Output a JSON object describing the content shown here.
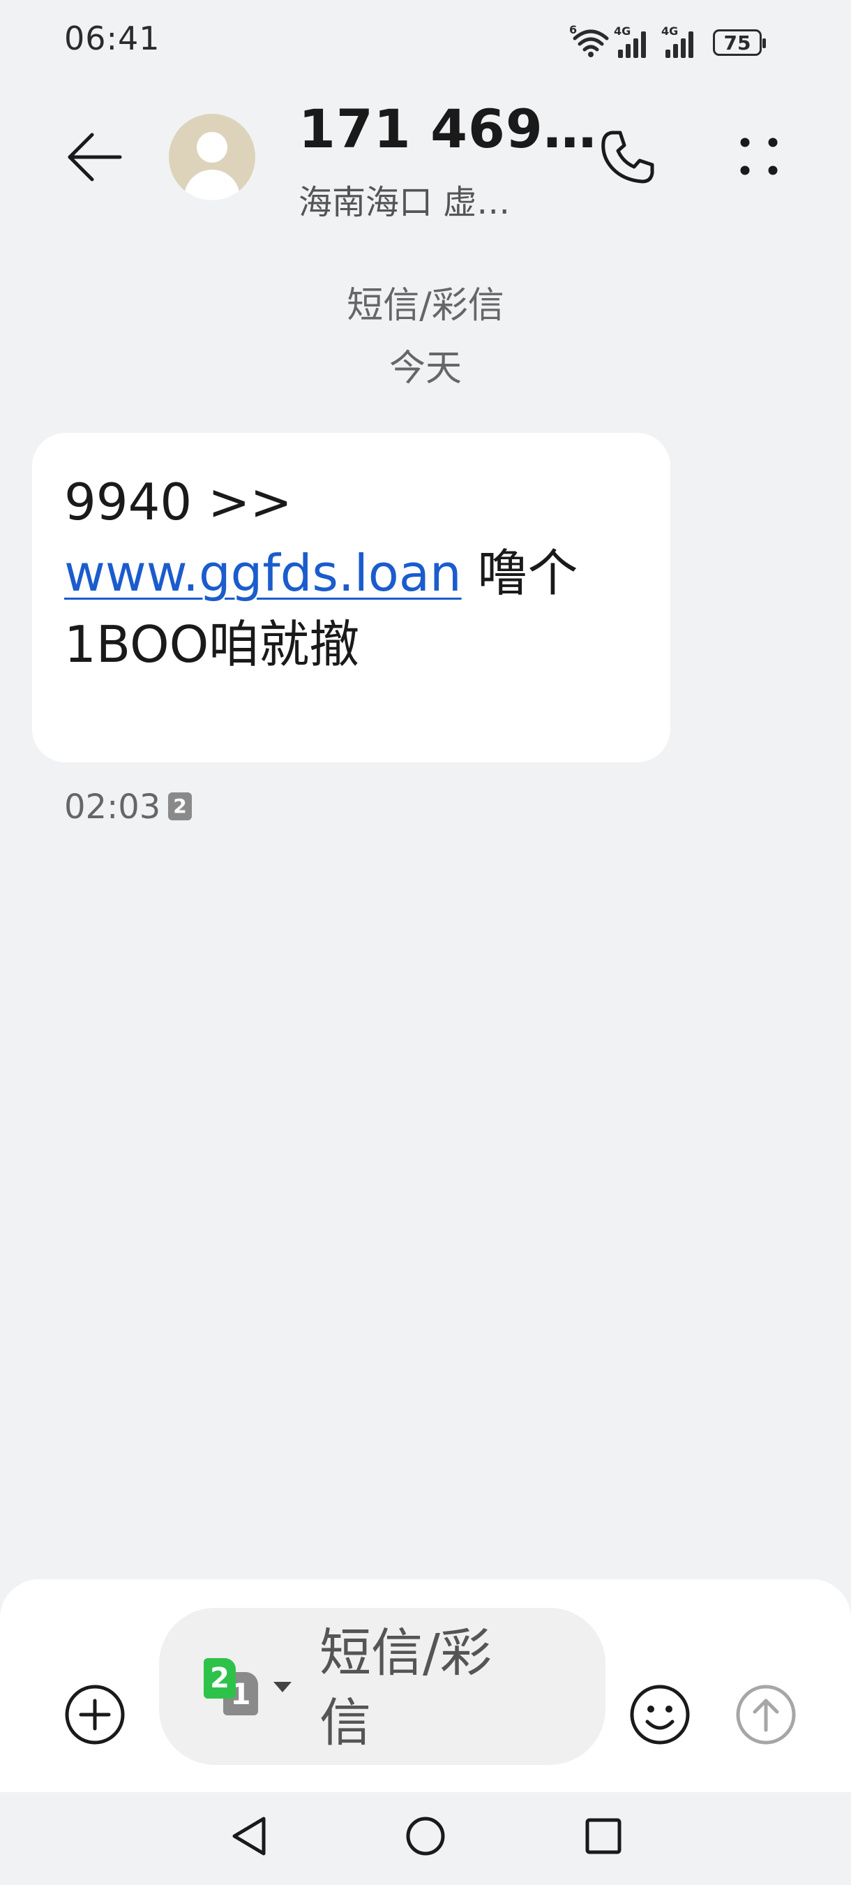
{
  "status_bar": {
    "time": "06:41",
    "wifi_tag": "6",
    "sim1_tag": "4G",
    "sim2_tag": "4G",
    "battery": "75"
  },
  "header": {
    "contact_name": "171 469…",
    "contact_location": "海南海口 虚…",
    "icons": [
      "back-arrow-icon",
      "avatar",
      "phone-icon",
      "more-icon"
    ]
  },
  "conversation": {
    "channel_label": "短信/彩信",
    "date_label": "今天",
    "messages": [
      {
        "line1": "9940 >>",
        "link": "www.ggfds.loan",
        "after_link": " 噜个",
        "line3": "1BOO咱就撤",
        "time": "02:03",
        "sim_badge": "2"
      }
    ]
  },
  "composer": {
    "sim_primary": "2",
    "sim_secondary": "1",
    "placeholder": "短信/彩信",
    "icons": [
      "add-icon",
      "sim-selector",
      "emoji-icon",
      "send-icon"
    ]
  },
  "colors": {
    "background": "#f1f2f4",
    "bubble": "#ffffff",
    "link": "#1b5ccd",
    "sim_green": "#2ec24a"
  }
}
